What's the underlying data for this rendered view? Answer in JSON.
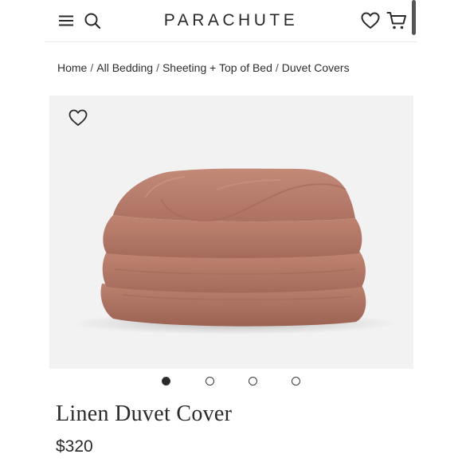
{
  "header": {
    "brand": "PARACHUTE",
    "menu_icon": "hamburger-menu-icon",
    "search_icon": "search-icon",
    "wishlist_icon": "heart-icon",
    "cart_icon": "cart-icon"
  },
  "breadcrumb": {
    "items": [
      "Home",
      "All Bedding",
      "Sheeting + Top of Bed",
      "Duvet Covers"
    ],
    "separator": "/"
  },
  "product": {
    "title": "Linen Duvet Cover",
    "price": "$320",
    "image_icon": "duvet-product-image",
    "favorite_icon": "heart-outline-icon",
    "image_count": 4,
    "active_image_index": 0,
    "fabric_color": "#b97c6a",
    "background_color": "#f2f2f2"
  }
}
